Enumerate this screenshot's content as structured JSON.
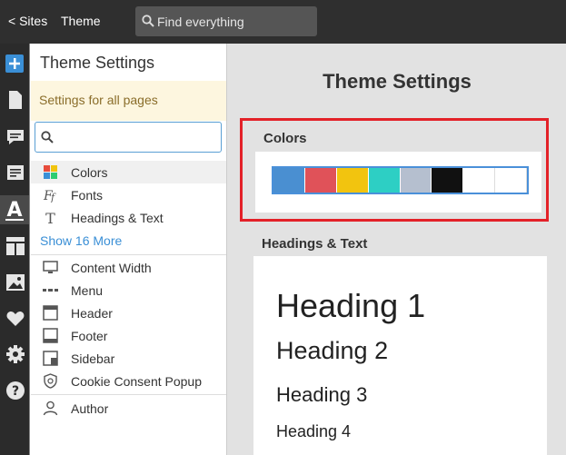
{
  "topbar": {
    "back_label": "< Sites",
    "title": "Theme",
    "search_placeholder": "Find everything"
  },
  "rail": {
    "icons": [
      "plus-icon",
      "page-icon",
      "comment-icon",
      "form-icon",
      "theme-icon",
      "layout-icon",
      "image-icon",
      "heart-icon",
      "gear-icon",
      "help-icon"
    ],
    "active": "theme-icon"
  },
  "panel": {
    "title": "Theme Settings",
    "note": "Settings for all pages",
    "search_value": "",
    "items": [
      {
        "label": "Colors",
        "icon": "colors-icon"
      },
      {
        "label": "Fonts",
        "icon": "fonts-icon"
      },
      {
        "label": "Headings & Text",
        "icon": "text-icon"
      }
    ],
    "show_more": "Show 16 More",
    "layout_items": [
      {
        "label": "Content Width",
        "icon": "monitor-icon"
      },
      {
        "label": "Menu",
        "icon": "menu-icon"
      },
      {
        "label": "Header",
        "icon": "header-icon"
      },
      {
        "label": "Footer",
        "icon": "footer-icon"
      },
      {
        "label": "Sidebar",
        "icon": "sidebar-icon"
      },
      {
        "label": "Cookie Consent Popup",
        "icon": "cookie-icon"
      }
    ],
    "author_item": {
      "label": "Author",
      "icon": "user-icon"
    }
  },
  "preview": {
    "title": "Theme Settings",
    "colors_label": "Colors",
    "swatches": [
      "#4a8fd1",
      "#e05259",
      "#f2c40f",
      "#2dcfc4",
      "#b5bfcf",
      "#111111",
      "#ffffff",
      "#ffffff"
    ],
    "headings_label": "Headings & Text",
    "h1": "Heading 1",
    "h2": "Heading 2",
    "h3": "Heading 3",
    "h4": "Heading 4"
  },
  "colors": {
    "accent": "#3a8fd6",
    "highlight": "#e32128",
    "note_bg": "#fdf6df"
  }
}
